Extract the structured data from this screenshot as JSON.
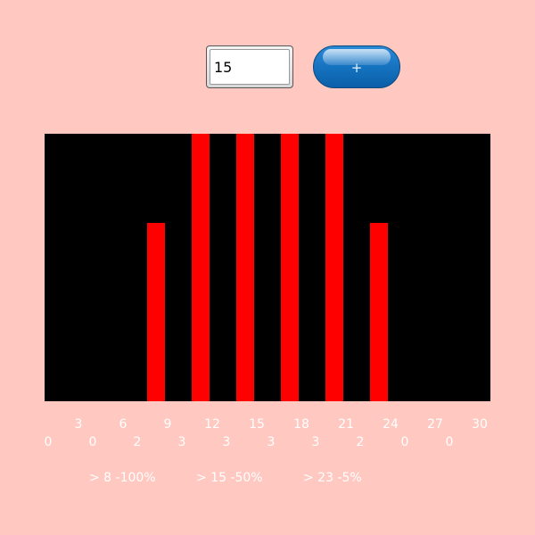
{
  "controls": {
    "input_value": "15",
    "add_button_label": "+"
  },
  "chart_data": {
    "type": "bar",
    "x": [
      7.5,
      10.5,
      13.5,
      16.5,
      19.5,
      22.5
    ],
    "values": [
      2,
      3,
      3,
      3,
      3,
      2
    ],
    "xlim": [
      0,
      30
    ],
    "ylim": [
      0,
      3
    ],
    "x_ticks": [
      "3",
      "6",
      "9",
      "12",
      "15",
      "18",
      "21",
      "24",
      "27",
      "30"
    ],
    "bin_counts": [
      "0",
      "0",
      "2",
      "3",
      "3",
      "3",
      "3",
      "2",
      "0",
      "0"
    ],
    "colors": {
      "background": "#ffc8c0",
      "plot": "#000000",
      "bar": "#ff0000",
      "text": "#ffffff"
    }
  },
  "thresholds": [
    {
      "label": "> 8 -100%"
    },
    {
      "label": "> 15 -50%"
    },
    {
      "label": "> 23 -5%"
    }
  ]
}
